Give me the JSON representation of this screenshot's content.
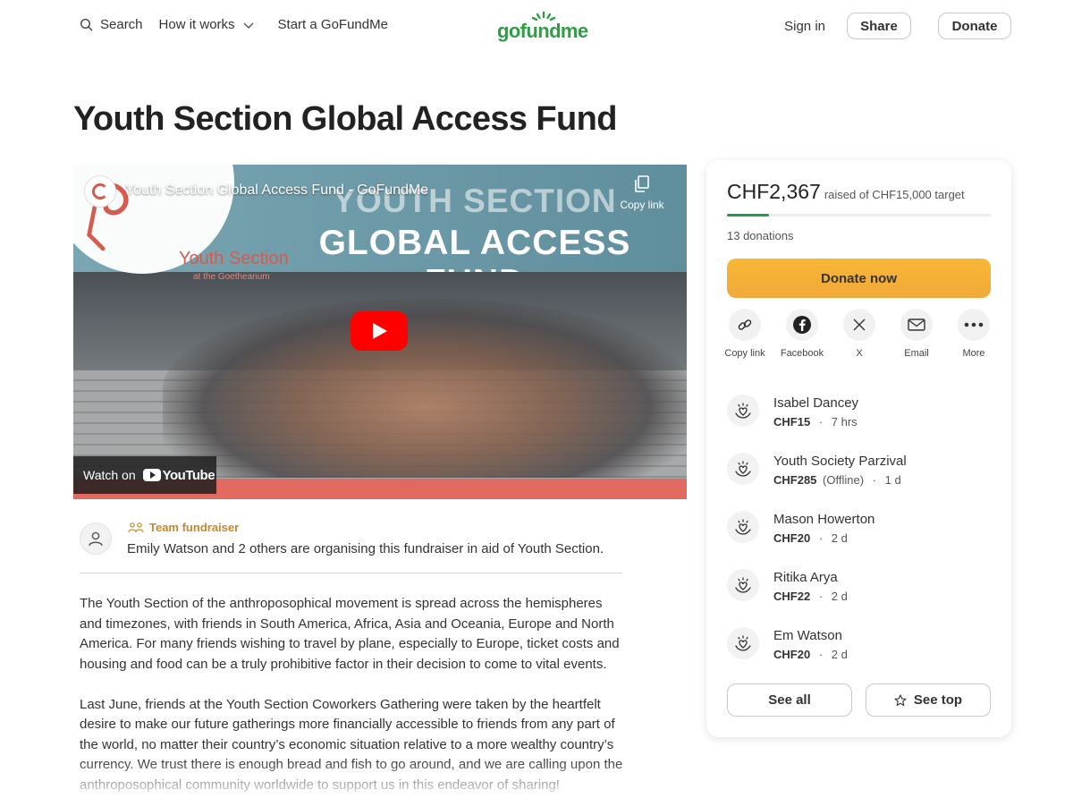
{
  "header": {
    "search_label": "Search",
    "how_it_works_label": "How it works",
    "start_label": "Start a GoFundMe",
    "logo_text": "gofundme",
    "sign_in_label": "Sign in",
    "share_label": "Share",
    "donate_label": "Donate"
  },
  "page": {
    "title": "Youth Section Global Access Fund"
  },
  "video": {
    "title": "Youth Section Global Access Fund - GoFundMe",
    "banner_line1": "YOUTH SECTION",
    "banner_line2": "GLOBAL ACCESS FUND",
    "circle_line1": "Youth Section",
    "circle_line2": "at the Goetheanum",
    "copy_link_label": "Copy link",
    "watch_on_label": "Watch on",
    "youtube_label": "YouTube"
  },
  "organiser": {
    "team_label": "Team fundraiser",
    "description": "Emily Watson and 2 others are organising this fundraiser in aid of Youth Section."
  },
  "story": {
    "paragraphs": [
      "The Youth Section of the anthroposophical movement is spread across the hemispheres and timezones, with friends in South America, Africa, Asia and Oceania, Europe and North America. For many friends wishing to travel by plane, especially to Europe, ticket costs and housing and food can be a truly prohibitive factor in their decision to come to vital events.",
      "Last June, friends at the Youth Section Coworkers Gathering were taken by the heartfelt desire to make our future gatherings more financially accessible to friends from any part of the world, no matter their country’s economic situation relative to a more wealthy country’s currency. We trust there is enough bread and fish to go around, and we are calling upon the anthroposophical community worldwide to support us in this endeavor of sharing!"
    ]
  },
  "sidebar": {
    "raised": "CHF2,367",
    "raised_sub": "raised of CHF15,000 target",
    "progress_fraction": 0.158,
    "donation_count": "13 donations",
    "donate_now_label": "Donate now",
    "share_options": [
      {
        "label": "Copy link",
        "icon": "link-icon"
      },
      {
        "label": "Facebook",
        "icon": "facebook-icon"
      },
      {
        "label": "X",
        "icon": "x-icon"
      },
      {
        "label": "Email",
        "icon": "email-icon"
      },
      {
        "label": "More",
        "icon": "more-icon"
      }
    ],
    "donors": [
      {
        "name": "Isabel Dancey",
        "amount": "CHF15",
        "note": "",
        "time": "7 hrs"
      },
      {
        "name": "Youth Society Parzival",
        "amount": "CHF285",
        "note": "(Offline)",
        "time": "1 d"
      },
      {
        "name": "Mason Howerton",
        "amount": "CHF20",
        "note": "",
        "time": "2 d"
      },
      {
        "name": "Ritika Arya",
        "amount": "CHF22",
        "note": "",
        "time": "2 d"
      },
      {
        "name": "Em Watson",
        "amount": "CHF20",
        "note": "",
        "time": "2 d"
      }
    ],
    "dot": "·",
    "see_all_label": "See all",
    "see_top_label": "See top"
  },
  "colors": {
    "brand_green": "#2f9e44",
    "donate_orange": "#f5ae3a",
    "team_gold": "#c9862a",
    "youtube_red": "#ff0000"
  }
}
